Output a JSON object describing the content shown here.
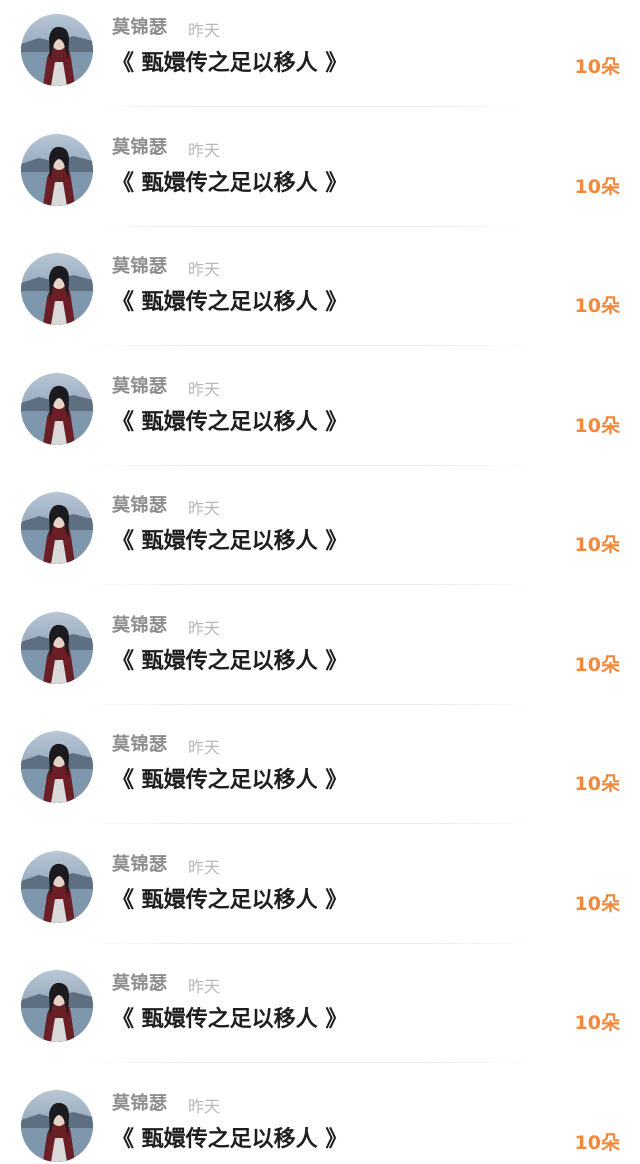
{
  "colors": {
    "name": "#8d8d8d",
    "time": "#b9b9b9",
    "title": "#1e1e1e",
    "gift_count": "#f2883c",
    "background": "#ffffff"
  },
  "items": [
    {
      "user": "莫锦瑟",
      "time": "昨天",
      "title": "《 甄嬛传之足以移人 》",
      "gift_count": "10朵",
      "avatar_icon": "user-avatar"
    },
    {
      "user": "莫锦瑟",
      "time": "昨天",
      "title": "《 甄嬛传之足以移人 》",
      "gift_count": "10朵",
      "avatar_icon": "user-avatar"
    },
    {
      "user": "莫锦瑟",
      "time": "昨天",
      "title": "《 甄嬛传之足以移人 》",
      "gift_count": "10朵",
      "avatar_icon": "user-avatar"
    },
    {
      "user": "莫锦瑟",
      "time": "昨天",
      "title": "《 甄嬛传之足以移人 》",
      "gift_count": "10朵",
      "avatar_icon": "user-avatar"
    },
    {
      "user": "莫锦瑟",
      "time": "昨天",
      "title": "《 甄嬛传之足以移人 》",
      "gift_count": "10朵",
      "avatar_icon": "user-avatar"
    },
    {
      "user": "莫锦瑟",
      "time": "昨天",
      "title": "《 甄嬛传之足以移人 》",
      "gift_count": "10朵",
      "avatar_icon": "user-avatar"
    },
    {
      "user": "莫锦瑟",
      "time": "昨天",
      "title": "《 甄嬛传之足以移人 》",
      "gift_count": "10朵",
      "avatar_icon": "user-avatar"
    },
    {
      "user": "莫锦瑟",
      "time": "昨天",
      "title": "《 甄嬛传之足以移人 》",
      "gift_count": "10朵",
      "avatar_icon": "user-avatar"
    },
    {
      "user": "莫锦瑟",
      "time": "昨天",
      "title": "《 甄嬛传之足以移人 》",
      "gift_count": "10朵",
      "avatar_icon": "user-avatar"
    },
    {
      "user": "莫锦瑟",
      "time": "昨天",
      "title": "《 甄嬛传之足以移人 》",
      "gift_count": "10朵",
      "avatar_icon": "user-avatar"
    }
  ]
}
